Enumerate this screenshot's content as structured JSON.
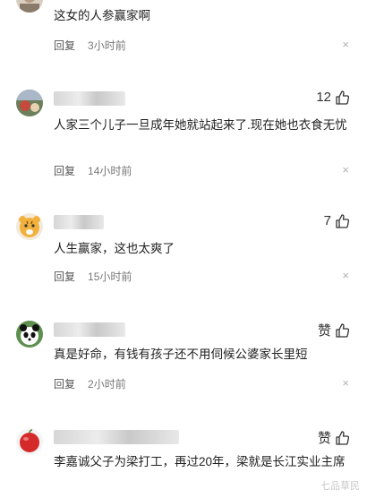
{
  "comments": [
    {
      "text": "这女的人参赢家啊",
      "reply_label": "回复",
      "time": "3小时前",
      "close": "×",
      "likes": "",
      "avatar_icon": "avatar-icon"
    },
    {
      "text": "人家三个儿子一旦成年她就站起来了.现在她也衣食无忧",
      "reply_label": "回复",
      "time": "14小时前",
      "close": "×",
      "likes": "12",
      "avatar_icon": "avatar-icon"
    },
    {
      "text": "人生赢家，这也太爽了",
      "reply_label": "回复",
      "time": "15小时前",
      "close": "×",
      "likes": "7",
      "avatar_icon": "tiger-avatar-icon"
    },
    {
      "text": "真是好命，有钱有孩子还不用伺候公婆家长里短",
      "reply_label": "回复",
      "time": "2小时前",
      "close": "×",
      "likes": "赞",
      "avatar_icon": "panda-avatar-icon"
    },
    {
      "text": "李嘉诚父子为梁打工，再过20年，梁就是长江实业主席",
      "reply_label": "",
      "time": "",
      "close": "",
      "likes": "赞",
      "avatar_icon": "apple-avatar-icon"
    }
  ],
  "watermark": "七品草民",
  "colors": {
    "text": "#222222",
    "meta": "#555555",
    "close": "#b0b0b0"
  }
}
